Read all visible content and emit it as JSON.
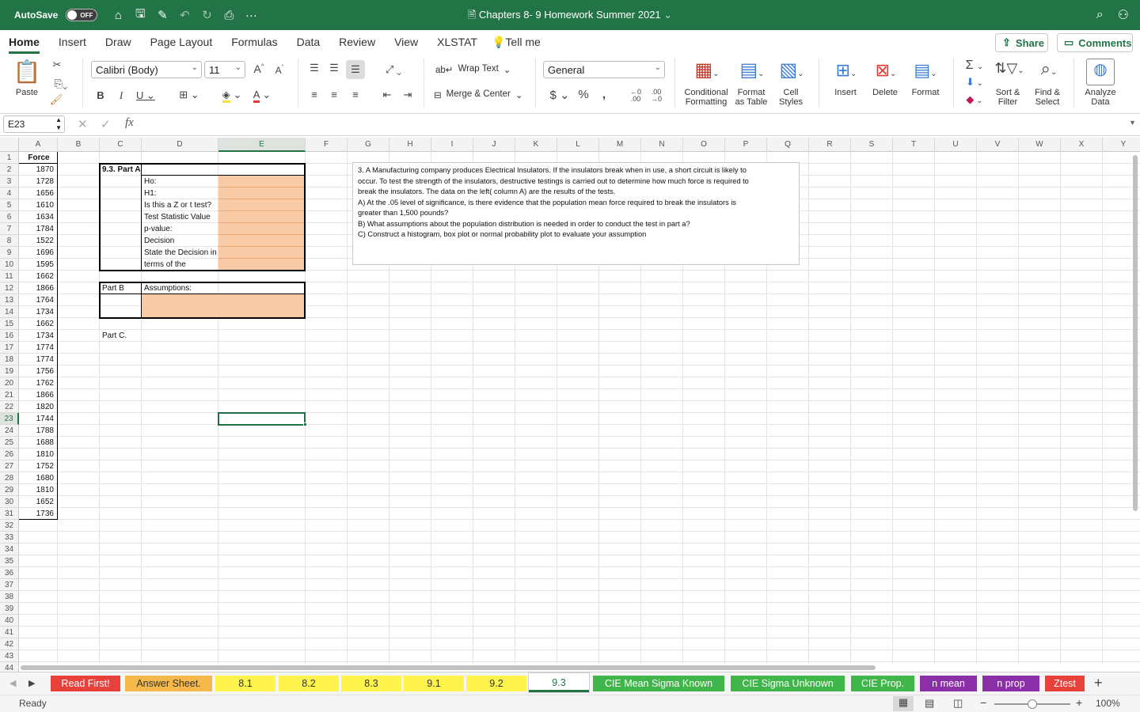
{
  "titlebar": {
    "autosave_label": "AutoSave",
    "autosave_state": "OFF",
    "document_title": "Chapters 8- 9 Homework Summer 2021",
    "accent_color": "#227447"
  },
  "ribbon_tabs": [
    "Home",
    "Insert",
    "Draw",
    "Page Layout",
    "Formulas",
    "Data",
    "Review",
    "View",
    "XLSTAT"
  ],
  "tell_me": "Tell me",
  "share_label": "Share",
  "comments_label": "Comments",
  "ribbon": {
    "paste": "Paste",
    "font_name": "Calibri (Body)",
    "font_size": "11",
    "wrap_text": "Wrap Text",
    "merge_center": "Merge & Center",
    "number_format": "General",
    "conditional_formatting": [
      "Conditional",
      "Formatting"
    ],
    "format_as_table": [
      "Format",
      "as Table"
    ],
    "cell_styles": [
      "Cell",
      "Styles"
    ],
    "insert": "Insert",
    "delete": "Delete",
    "format": "Format",
    "sort_filter": [
      "Sort &",
      "Filter"
    ],
    "find_select": [
      "Find &",
      "Select"
    ],
    "analyze_data": [
      "Analyze",
      "Data"
    ]
  },
  "formula_bar": {
    "name_box": "E23",
    "formula": ""
  },
  "grid": {
    "columns": [
      "A",
      "B",
      "C",
      "D",
      "E",
      "F",
      "G",
      "H",
      "I",
      "J",
      "K",
      "L",
      "M",
      "N",
      "O",
      "P",
      "Q",
      "R",
      "S",
      "T",
      "U",
      "V",
      "W",
      "X",
      "Y"
    ],
    "selected_column": "E",
    "selected_row": 23,
    "row_count": 44,
    "force_header": "Force",
    "force_values": [
      1870,
      1728,
      1656,
      1610,
      1634,
      1784,
      1522,
      1696,
      1595,
      1662,
      1866,
      1764,
      1734,
      1662,
      1734,
      1774,
      1774,
      1756,
      1762,
      1866,
      1820,
      1744,
      1788,
      1688,
      1810,
      1752,
      1680,
      1810,
      1652,
      1736
    ],
    "part_a_title": "9.3. Part A",
    "part_a_labels": [
      "Ho:",
      "H1:",
      "Is this a Z or t test?",
      "Test Statistic Value",
      "p-value:",
      "Decision",
      "State the Decision in",
      "terms of the"
    ],
    "part_b_title": "Part B",
    "part_b_label": "Assumptions:",
    "part_c_title": "Part C.",
    "answer_fill": "#f8cba6",
    "problem_text": [
      "3.  A Manufacturing company produces Electrical Insulators.  If the insulators break when in use, a short circuit is likely to",
      "occur.  To test the strength of the insulators, destructive testings is carried out to determine how much force is required to",
      "break the insulators.  The data on the left( column A) are the results of the tests.",
      "A) At the .05 level of significance, is there evidence that the population mean force required to break the insulators is",
      "greater than 1,500 pounds?",
      "B)  What assumptions about the population distribution is needed in order to conduct the test in part a?",
      "C) Construct a histogram, box plot or normal probability plot to evaluate your assumption"
    ]
  },
  "sheet_tabs": [
    {
      "label": "Read First!",
      "color": "#e8403a",
      "text": "#ffffff"
    },
    {
      "label": "Answer Sheet.",
      "color": "#f5b84a",
      "text": "#333333"
    },
    {
      "label": "8.1",
      "color": "#fff34d",
      "text": "#333333"
    },
    {
      "label": "8.2",
      "color": "#fff34d",
      "text": "#333333"
    },
    {
      "label": "8.3",
      "color": "#fff34d",
      "text": "#333333"
    },
    {
      "label": "9.1",
      "color": "#fff34d",
      "text": "#333333"
    },
    {
      "label": "9.2",
      "color": "#fff34d",
      "text": "#333333"
    },
    {
      "label": "9.3",
      "color": "#ffffff",
      "text": "#227447"
    },
    {
      "label": "CIE Mean Sigma Known",
      "color": "#3fb54a",
      "text": "#ffffff"
    },
    {
      "label": "CIE Sigma Unknown",
      "color": "#3fb54a",
      "text": "#ffffff"
    },
    {
      "label": "CIE Prop.",
      "color": "#3fb54a",
      "text": "#ffffff"
    },
    {
      "label": "n mean",
      "color": "#8b2fa8",
      "text": "#ffffff"
    },
    {
      "label": "n prop",
      "color": "#8b2fa8",
      "text": "#ffffff"
    },
    {
      "label": "Ztest",
      "color": "#e8403a",
      "text": "#ffffff"
    }
  ],
  "status": {
    "ready": "Ready",
    "zoom": "100%",
    "zoom_fraction": 0.5
  }
}
